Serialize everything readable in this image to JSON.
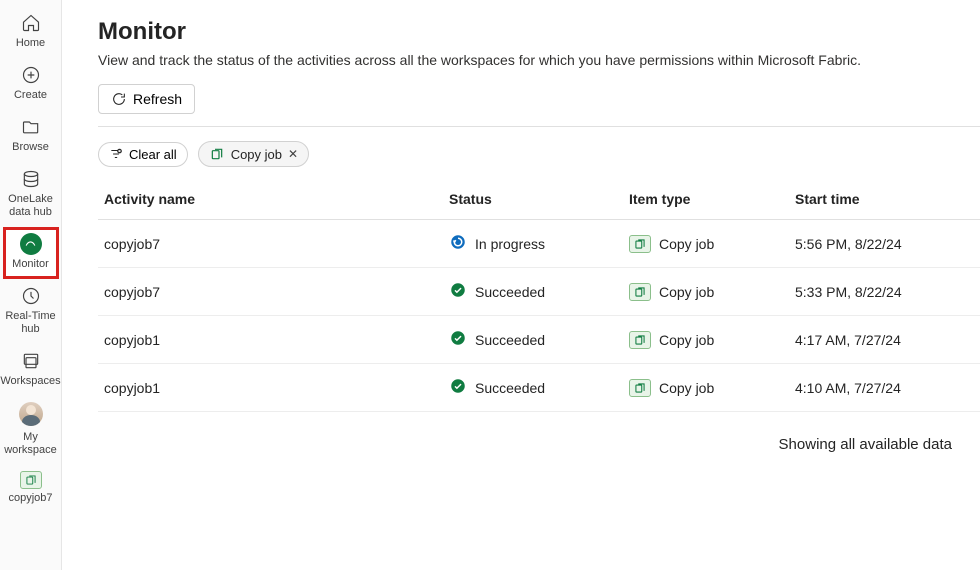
{
  "sidebar": {
    "items": [
      {
        "label": "Home",
        "icon": "home-icon"
      },
      {
        "label": "Create",
        "icon": "create-icon"
      },
      {
        "label": "Browse",
        "icon": "browse-icon"
      },
      {
        "label": "OneLake data hub",
        "icon": "datahub-icon"
      },
      {
        "label": "Monitor",
        "icon": "monitor-icon"
      },
      {
        "label": "Real-Time hub",
        "icon": "realtime-icon"
      },
      {
        "label": "Workspaces",
        "icon": "workspaces-icon"
      },
      {
        "label": "My workspace",
        "icon": "avatar-icon"
      },
      {
        "label": "copyjob7",
        "icon": "copyjob-icon"
      }
    ]
  },
  "page": {
    "title": "Monitor",
    "subtitle": "View and track the status of the activities across all the workspaces for which you have permissions within Microsoft Fabric."
  },
  "toolbar": {
    "refresh": "Refresh"
  },
  "filters": {
    "clear_all": "Clear all",
    "chip_label": "Copy job"
  },
  "table": {
    "headers": {
      "activity": "Activity name",
      "status": "Status",
      "item_type": "Item type",
      "start_time": "Start time"
    },
    "rows": [
      {
        "name": "copyjob7",
        "status": "In progress",
        "status_kind": "progress",
        "type": "Copy job",
        "start": "5:56 PM, 8/22/24"
      },
      {
        "name": "copyjob7",
        "status": "Succeeded",
        "status_kind": "success",
        "type": "Copy job",
        "start": "5:33 PM, 8/22/24"
      },
      {
        "name": "copyjob1",
        "status": "Succeeded",
        "status_kind": "success",
        "type": "Copy job",
        "start": "4:17 AM, 7/27/24"
      },
      {
        "name": "copyjob1",
        "status": "Succeeded",
        "status_kind": "success",
        "type": "Copy job",
        "start": "4:10 AM, 7/27/24"
      }
    ],
    "footer": "Showing all available data"
  }
}
